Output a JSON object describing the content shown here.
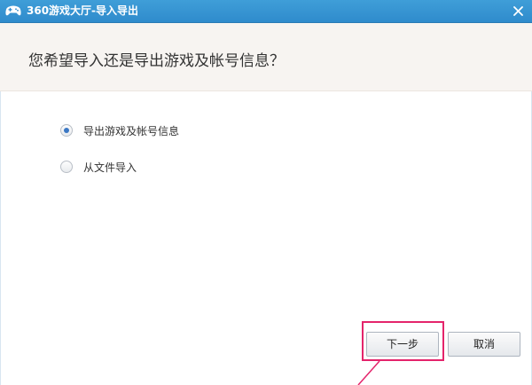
{
  "window": {
    "title": "360游戏大厅-导入导出",
    "close_glyph": "×",
    "accent_color": "#2f8bcc"
  },
  "header": {
    "question": "您希望导入还是导出游戏及帐号信息？"
  },
  "options": [
    {
      "label": "导出游戏及帐号信息",
      "checked": true
    },
    {
      "label": "从文件导入",
      "checked": false
    }
  ],
  "buttons": {
    "next_label": "下一步",
    "cancel_label": "取消"
  },
  "annotation": {
    "highlight_color": "#e4246b"
  }
}
